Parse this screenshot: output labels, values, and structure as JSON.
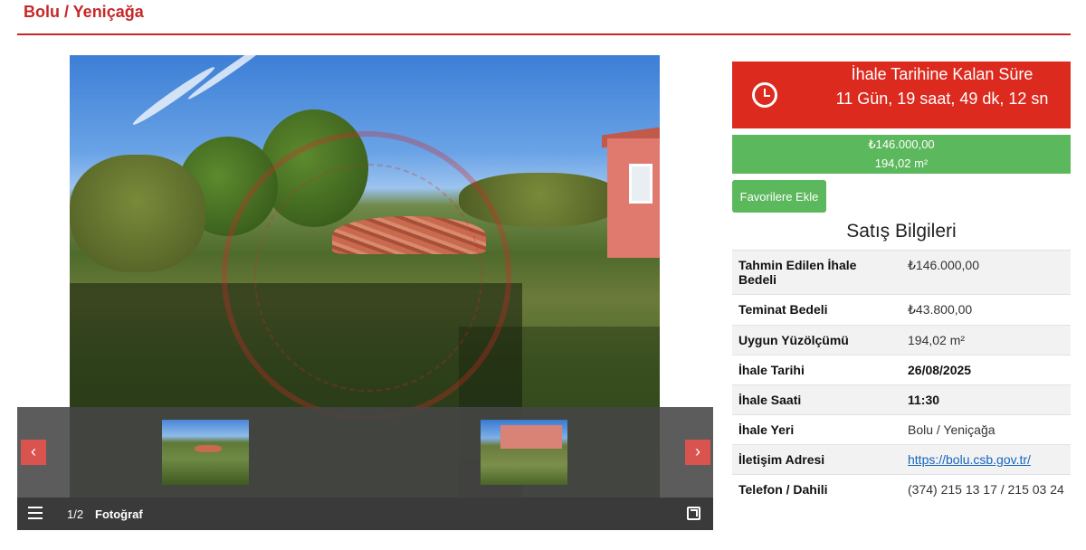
{
  "page": {
    "title": "Bolu / Yeniçağa"
  },
  "gallery": {
    "counter": "1/2",
    "label": "Fotoğraf",
    "prev_symbol": "‹",
    "next_symbol": "›",
    "thumbnails": [
      "photo-1",
      "photo-2"
    ]
  },
  "countdown": {
    "title": "İhale Tarihine Kalan Süre",
    "time": "11 Gün, 19 saat, 49 dk, 12 sn"
  },
  "price": {
    "amount": "₺146.000,00",
    "area": "194,02 m²"
  },
  "favorites_button": "Favorilere Ekle",
  "sale_info": {
    "title": "Satış Bilgileri",
    "rows": [
      {
        "label": "Tahmin Edilen İhale Bedeli",
        "value": "₺146.000,00"
      },
      {
        "label": "Teminat Bedeli",
        "value": "₺43.800,00"
      },
      {
        "label": "Uygun Yüzölçümü",
        "value": "194,02 m²"
      },
      {
        "label": "İhale Tarihi",
        "value": "26/08/2025"
      },
      {
        "label": "İhale Saati",
        "value": "11:30"
      },
      {
        "label": "İhale Yeri",
        "value": "Bolu / Yeniçağa"
      },
      {
        "label": "İletişim Adresi",
        "value": "https://bolu.csb.gov.tr/"
      },
      {
        "label": "Telefon / Dahili",
        "value": "(374) 215 13 17 / 215 03 24"
      }
    ]
  },
  "colors": {
    "accent_red": "#c62828",
    "countdown_red": "#dc2a1e",
    "success_green": "#5cb85c",
    "link_blue": "#1565c0"
  },
  "icons": [
    "clock-icon",
    "menu-icon",
    "expand-icon",
    "chevron-left-icon",
    "chevron-right-icon"
  ]
}
